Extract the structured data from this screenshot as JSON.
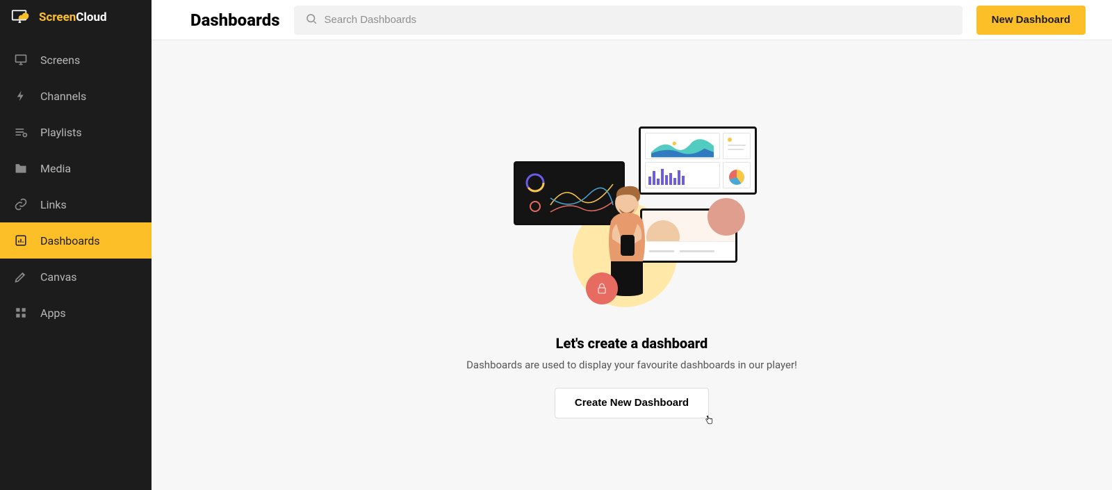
{
  "brand": {
    "a": "Screen",
    "b": "Cloud"
  },
  "sidebar": {
    "items": [
      {
        "label": "Screens"
      },
      {
        "label": "Channels"
      },
      {
        "label": "Playlists"
      },
      {
        "label": "Media"
      },
      {
        "label": "Links"
      },
      {
        "label": "Dashboards"
      },
      {
        "label": "Canvas"
      },
      {
        "label": "Apps"
      }
    ],
    "active_index": 5
  },
  "header": {
    "title": "Dashboards",
    "search_placeholder": "Search Dashboards",
    "new_button": "New Dashboard"
  },
  "empty_state": {
    "title": "Let's create a dashboard",
    "subtitle": "Dashboards are used to display your favourite dashboards in our player!",
    "cta": "Create New Dashboard"
  },
  "colors": {
    "accent": "#fdbf27",
    "sidebar_bg": "#1c1c1c"
  }
}
